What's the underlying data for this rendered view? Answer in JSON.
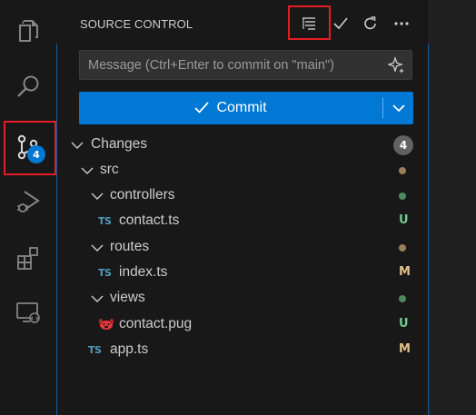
{
  "activity_bar": {
    "items": [
      {
        "icon": "explorer-icon"
      },
      {
        "icon": "search-icon"
      },
      {
        "icon": "source-control-icon",
        "badge": "4"
      },
      {
        "icon": "run-debug-icon"
      },
      {
        "icon": "extensions-icon"
      },
      {
        "icon": "remote-explorer-icon"
      }
    ]
  },
  "header": {
    "title": "SOURCE CONTROL",
    "actions": [
      "view-as-tree-icon",
      "check-icon",
      "refresh-icon",
      "more-actions-icon"
    ]
  },
  "commit": {
    "message_placeholder": "Message (Ctrl+Enter to commit on \"main\")",
    "message_value": "",
    "button_label": "Commit"
  },
  "changes": {
    "label": "Changes",
    "count": "4",
    "tree": {
      "src": "src",
      "controllers": "controllers",
      "contact_ts": "contact.ts",
      "contact_ts_status": "U",
      "routes": "routes",
      "index_ts": "index.ts",
      "index_ts_status": "M",
      "views": "views",
      "contact_pug": "contact.pug",
      "contact_pug_status": "U",
      "app_ts": "app.ts",
      "app_ts_status": "M",
      "ts_glyph": "TS"
    }
  },
  "colors": {
    "accent": "#0078d4",
    "untracked": "#73c991",
    "modified": "#e2c08d",
    "highlight": "#e51c23",
    "ts": "#519aba",
    "pug": "#e5383b"
  }
}
